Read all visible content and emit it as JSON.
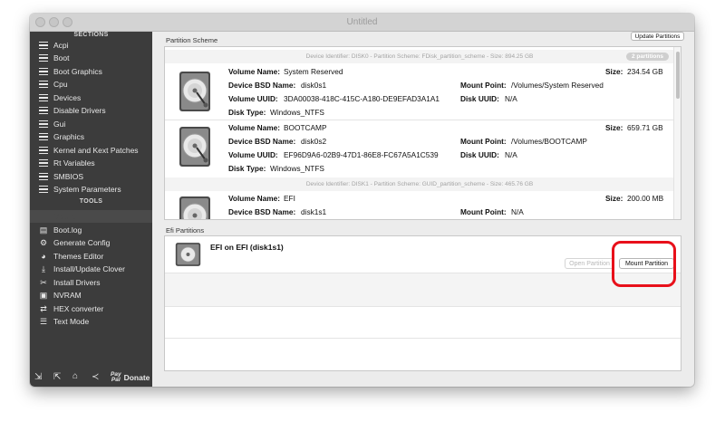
{
  "window": {
    "title": "Untitled"
  },
  "sidebar": {
    "sections_header": "SECTIONS",
    "sections": [
      "Acpi",
      "Boot",
      "Boot Graphics",
      "Cpu",
      "Devices",
      "Disable Drivers",
      "Gui",
      "Graphics",
      "Kernel and Kext Patches",
      "Rt Variables",
      "SMBIOS",
      "System Parameters"
    ],
    "tools_header": "TOOLS",
    "selected_tool": "Mount EFI",
    "tools": [
      {
        "label": "Boot.log",
        "icon": "document-icon"
      },
      {
        "label": "Generate Config",
        "icon": "gear-icon"
      },
      {
        "label": "Themes Editor",
        "icon": "palette-icon"
      },
      {
        "label": "Install/Update Clover",
        "icon": "download-icon"
      },
      {
        "label": "Install Drivers",
        "icon": "tools-icon"
      },
      {
        "label": "NVRAM",
        "icon": "chip-icon"
      },
      {
        "label": "HEX converter",
        "icon": "convert-icon"
      },
      {
        "label": "Text Mode",
        "icon": "text-icon"
      }
    ],
    "bottom_icons": [
      "import-icon",
      "export-icon",
      "home-icon",
      "share-icon"
    ],
    "donate": {
      "pay": "Pay",
      "pal": "Pal",
      "label": "Donate"
    }
  },
  "partition_scheme": {
    "label": "Partition Scheme",
    "update_button": "Update Partitions",
    "disks": [
      {
        "header": "Device Identifier: DISK0 - Partition Scheme: FDisk_partition_scheme - Size: 894.25 GB",
        "badge": "2 partitions",
        "partitions": [
          {
            "volume_name": "System Reserved",
            "bsd_name": "disk0s1",
            "uuid": "3DA00038-418C-415C-A180-DE9EFAD3A1A1",
            "disk_type": "Windows_NTFS",
            "size": "234.54 GB",
            "mount_point": "/Volumes/System Reserved",
            "disk_uuid": "N/A"
          },
          {
            "volume_name": "BOOTCAMP",
            "bsd_name": "disk0s2",
            "uuid": "EF96D9A6-02B9-47D1-86E8-FC67A5A1C539",
            "disk_type": "Windows_NTFS",
            "size": "659.71 GB",
            "mount_point": "/Volumes/BOOTCAMP",
            "disk_uuid": "N/A"
          }
        ]
      },
      {
        "header": "Device Identifier: DISK1 - Partition Scheme: GUID_partition_scheme - Size: 465.76 GB",
        "partitions": [
          {
            "volume_name": "EFI",
            "bsd_name": "disk1s1",
            "size": "200.00 MB",
            "mount_point": "N/A"
          }
        ]
      }
    ],
    "field_labels": {
      "volume_name": "Volume Name:",
      "bsd_name": "Device BSD Name:",
      "uuid": "Volume UUID:",
      "disk_type": "Disk Type:",
      "size": "Size:",
      "mount_point": "Mount Point:",
      "disk_uuid": "Disk UUID:"
    }
  },
  "efi_partitions": {
    "label": "Efi Partitions",
    "entry": "EFI on EFI (disk1s1)",
    "open_button": "Open Partition",
    "mount_button": "Mount Partition"
  },
  "colors": {
    "highlight": "#e8101a",
    "sidebar_bg": "#3c3c3c"
  }
}
